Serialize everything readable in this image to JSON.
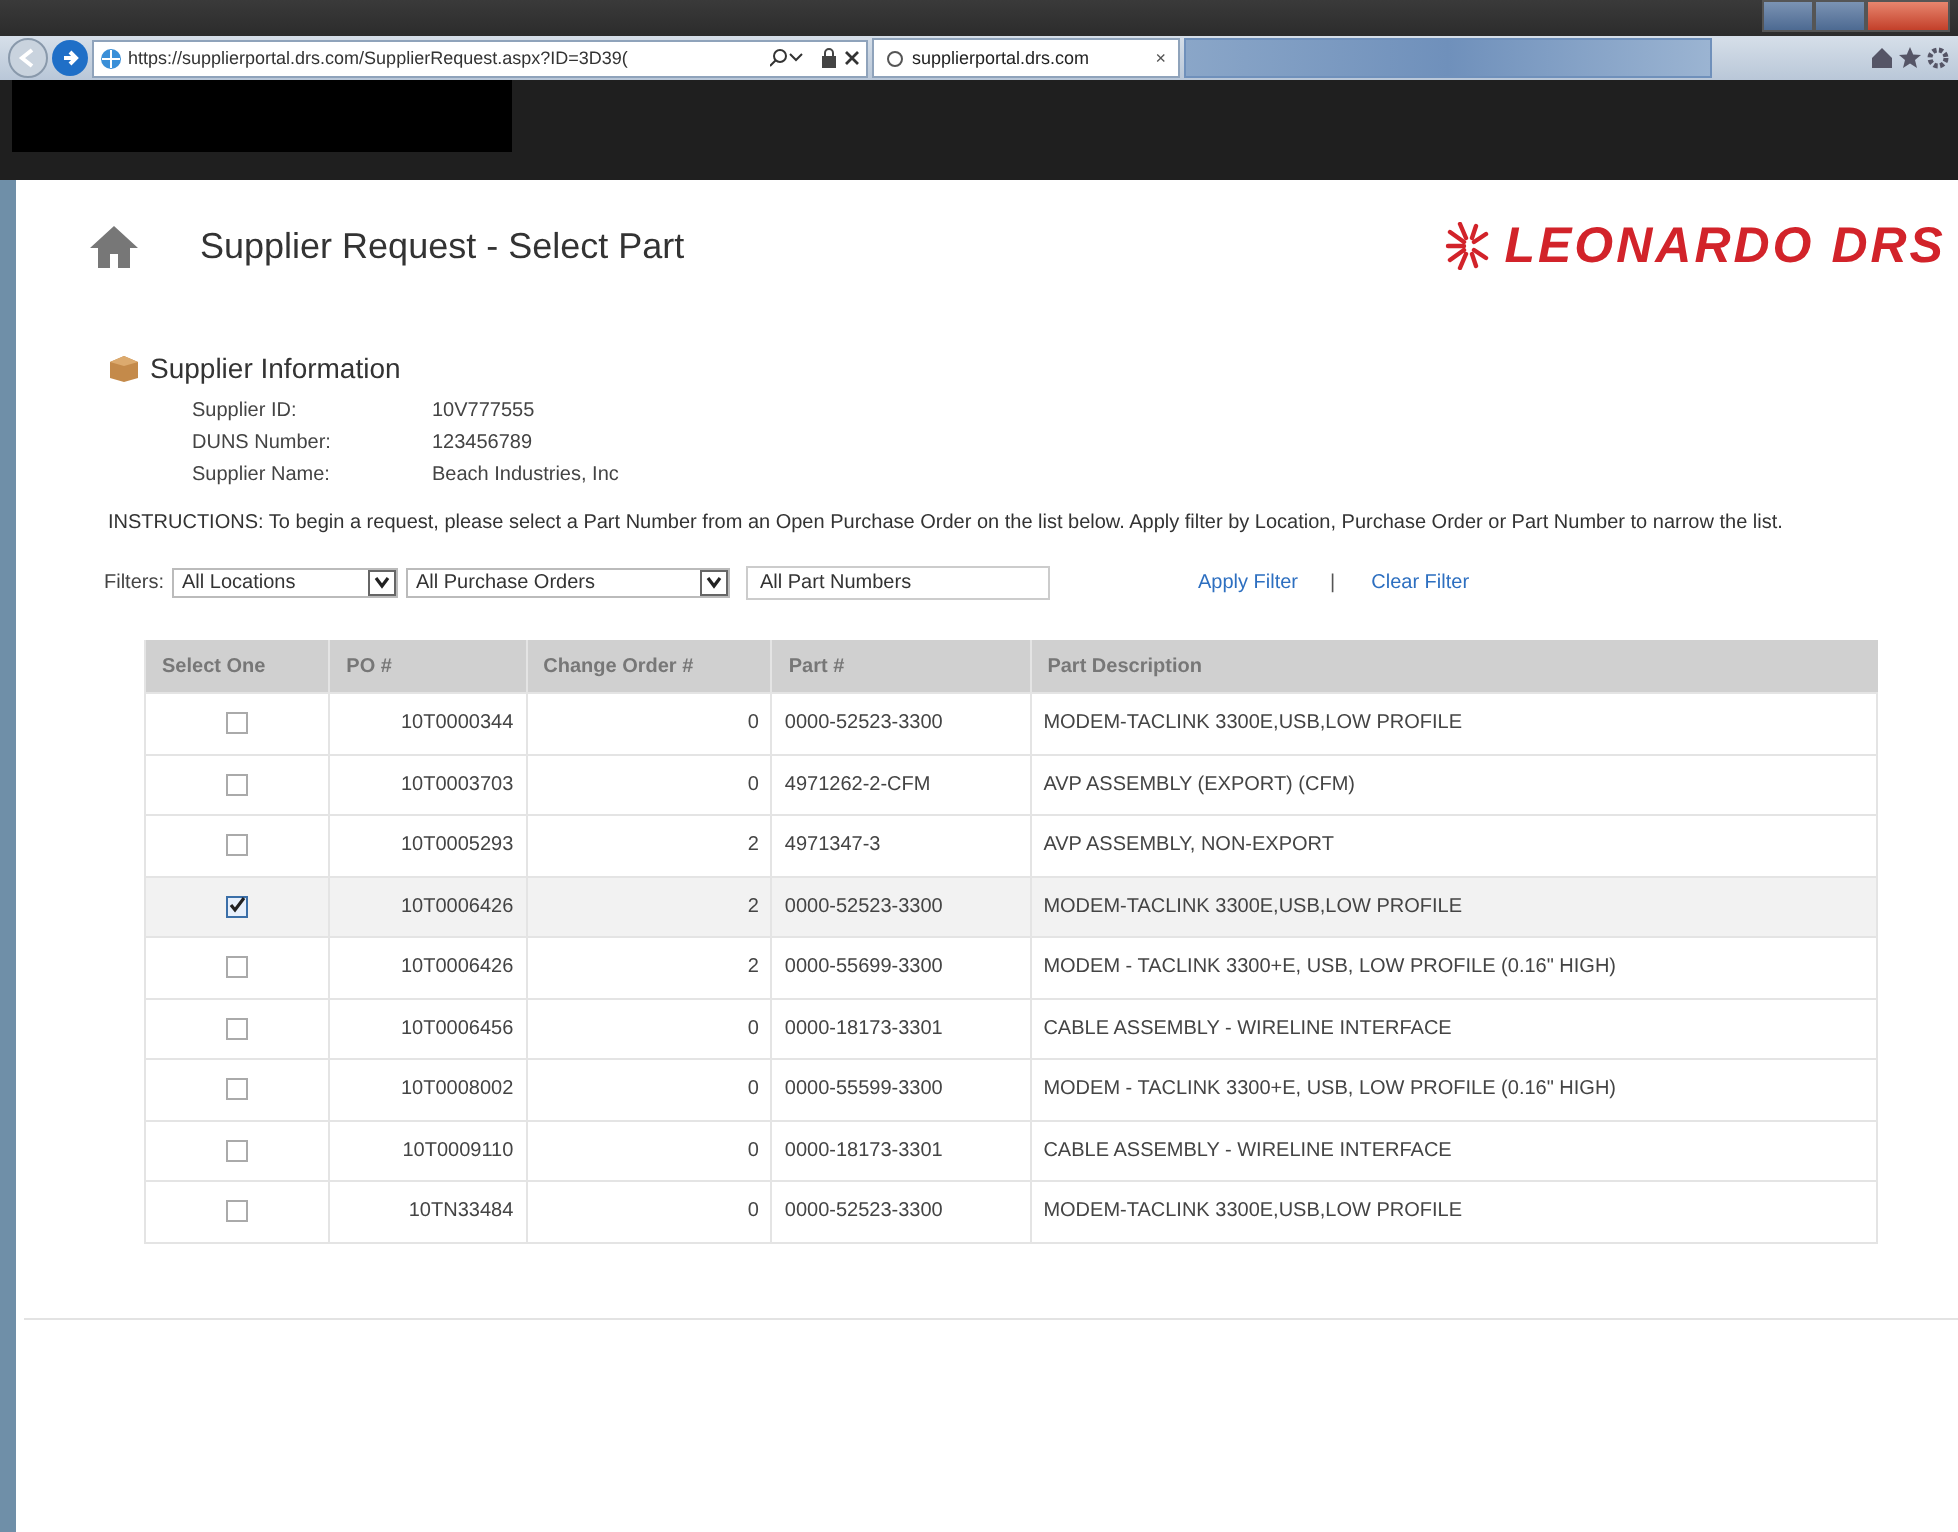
{
  "browser": {
    "address": "https://supplierportal.drs.com/SupplierRequest.aspx?ID=3D39(",
    "tabs": [
      {
        "label": "supplierportal.drs.com",
        "close": "×",
        "selected": true
      },
      {
        "selected": false
      }
    ]
  },
  "header": {
    "title": "Supplier Request - Select Part",
    "logo": "LEONARDO DRS"
  },
  "supplier_info": {
    "heading": "Supplier Information",
    "fields": [
      {
        "label": "Supplier ID:",
        "value": "10V777555"
      },
      {
        "label": "DUNS Number:",
        "value": "123456789"
      },
      {
        "label": "Supplier Name:",
        "value": "Beach Industries, Inc"
      }
    ]
  },
  "instructions": "INSTRUCTIONS:  To begin a request, please select a Part Number from an Open Purchase Order on the list below. Apply filter by Location, Purchase Order or Part Number to narrow the list.",
  "filters": {
    "label": "Filters:",
    "location": "All Locations",
    "purchase_order": "All Purchase Orders",
    "part_number": "All Part Numbers",
    "apply": "Apply Filter",
    "separator": "|",
    "clear": "Clear Filter"
  },
  "table": {
    "columns": [
      "Select One",
      "PO #",
      "Change Order #",
      "Part #",
      "Part Description"
    ],
    "rows": [
      {
        "checked": false,
        "po": "10T0000344",
        "change_order": "0",
        "part": "0000-52523-3300",
        "description": "MODEM-TACLINK 3300E,USB,LOW PROFILE"
      },
      {
        "checked": false,
        "po": "10T0003703",
        "change_order": "0",
        "part": "4971262-2-CFM",
        "description": "AVP ASSEMBLY (EXPORT) (CFM)"
      },
      {
        "checked": false,
        "po": "10T0005293",
        "change_order": "2",
        "part": "4971347-3",
        "description": "AVP ASSEMBLY, NON-EXPORT"
      },
      {
        "checked": true,
        "po": "10T0006426",
        "change_order": "2",
        "part": "0000-52523-3300",
        "description": "MODEM-TACLINK 3300E,USB,LOW PROFILE"
      },
      {
        "checked": false,
        "po": "10T0006426",
        "change_order": "2",
        "part": "0000-55699-3300",
        "description": "MODEM - TACLINK 3300+E, USB, LOW PROFILE (0.16\" HIGH)"
      },
      {
        "checked": false,
        "po": "10T0006456",
        "change_order": "0",
        "part": "0000-18173-3301",
        "description": "CABLE ASSEMBLY - WIRELINE INTERFACE"
      },
      {
        "checked": false,
        "po": "10T0008002",
        "change_order": "0",
        "part": "0000-55599-3300",
        "description": "MODEM - TACLINK 3300+E, USB, LOW PROFILE (0.16\" HIGH)"
      },
      {
        "checked": false,
        "po": "10T0009110",
        "change_order": "0",
        "part": "0000-18173-3301",
        "description": "CABLE ASSEMBLY - WIRELINE INTERFACE"
      },
      {
        "checked": false,
        "po": "10TN33484",
        "change_order": "0",
        "part": "0000-52523-3300",
        "description": "MODEM-TACLINK 3300E,USB,LOW PROFILE"
      }
    ]
  }
}
